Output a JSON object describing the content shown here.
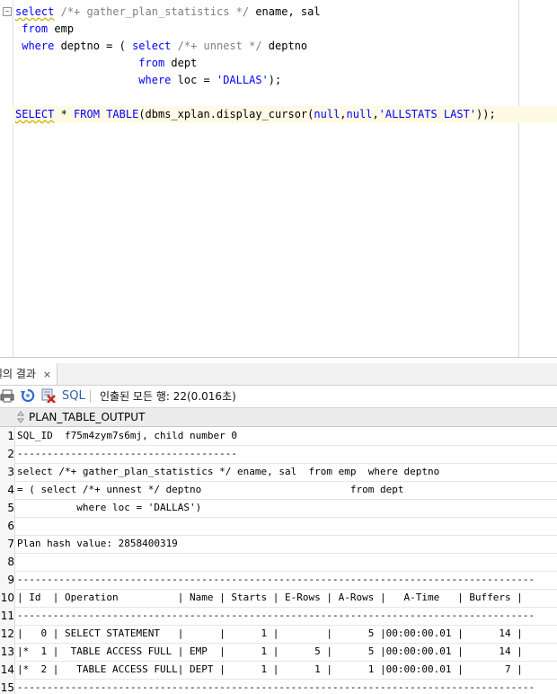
{
  "editor": {
    "lines": [
      [
        {
          "t": "select",
          "c": "kw sq"
        },
        {
          "t": " "
        },
        {
          "t": "/*+ gather_plan_statistics */",
          "c": "cm"
        },
        {
          "t": " ename, sal"
        }
      ],
      [
        {
          "t": " "
        },
        {
          "t": "from",
          "c": "kw"
        },
        {
          "t": " emp"
        }
      ],
      [
        {
          "t": " "
        },
        {
          "t": "where",
          "c": "kw"
        },
        {
          "t": " deptno = ( "
        },
        {
          "t": "select",
          "c": "kw"
        },
        {
          "t": " "
        },
        {
          "t": "/*+ unnest */",
          "c": "cm"
        },
        {
          "t": " deptno"
        }
      ],
      [
        {
          "t": "                   "
        },
        {
          "t": "from",
          "c": "kw"
        },
        {
          "t": " dept"
        }
      ],
      [
        {
          "t": "                   "
        },
        {
          "t": "where",
          "c": "kw"
        },
        {
          "t": " loc = "
        },
        {
          "t": "'DALLAS'",
          "c": "str"
        },
        {
          "t": ");"
        }
      ],
      [
        {
          "t": ""
        }
      ],
      [
        {
          "t": "SELECT",
          "c": "kw sq"
        },
        {
          "t": " * "
        },
        {
          "t": "FROM",
          "c": "kw"
        },
        {
          "t": " "
        },
        {
          "t": "TABLE",
          "c": "kw"
        },
        {
          "t": "(dbms_xplan.display_cursor("
        },
        {
          "t": "null",
          "c": "kw"
        },
        {
          "t": ","
        },
        {
          "t": "null",
          "c": "kw"
        },
        {
          "t": ","
        },
        {
          "t": "'ALLSTATS LAST'",
          "c": "str"
        },
        {
          "t": "));"
        }
      ]
    ]
  },
  "results": {
    "tab_label": "질의 결과",
    "tab_close": "×",
    "toolbar": {
      "sql_label": "SQL",
      "separator": "|",
      "status": "인출된 모든 행: 22(0.016초)"
    },
    "column_header": "PLAN_TABLE_OUTPUT",
    "rows": [
      {
        "num": "1",
        "text": "SQL_ID  f75m4zym7s6mj, child number 0"
      },
      {
        "num": "2",
        "text": "-------------------------------------"
      },
      {
        "num": "3",
        "text": "select /*+ gather_plan_statistics */ ename, sal  from emp  where deptno"
      },
      {
        "num": "4",
        "text": "= ( select /*+ unnest */ deptno                         from dept"
      },
      {
        "num": "5",
        "text": "          where loc = 'DALLAS')"
      },
      {
        "num": "6",
        "text": ""
      },
      {
        "num": "7",
        "text": "Plan hash value: 2858400319"
      },
      {
        "num": "8",
        "text": ""
      },
      {
        "num": "9",
        "text": "---------------------------------------------------------------------------------------"
      },
      {
        "num": "10",
        "text": "| Id  | Operation          | Name | Starts | E-Rows | A-Rows |   A-Time   | Buffers |"
      },
      {
        "num": "11",
        "text": "---------------------------------------------------------------------------------------"
      },
      {
        "num": "12",
        "text": "|   0 | SELECT STATEMENT   |      |      1 |        |      5 |00:00:00.01 |      14 |"
      },
      {
        "num": "13",
        "text": "|*  1 |  TABLE ACCESS FULL | EMP  |      1 |      5 |      5 |00:00:00.01 |      14 |"
      },
      {
        "num": "14",
        "text": "|*  2 |   TABLE ACCESS FULL| DEPT |      1 |      1 |      1 |00:00:00.01 |       7 |"
      },
      {
        "num": "15",
        "text": "---------------------------------------------------------------------------------------"
      }
    ]
  },
  "colors": {
    "keyword": "#0000ff",
    "comment": "#808080",
    "highlight": "#fffae6"
  }
}
